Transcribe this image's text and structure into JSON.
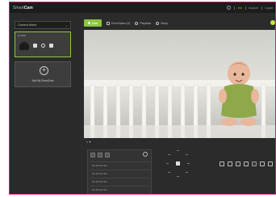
{
  "app": {
    "logo_prefix": "Smart",
    "logo_suffix": "Cam"
  },
  "top_nav": {
    "link1": "Inst",
    "link2": "Account",
    "link3": "Logout"
  },
  "sidebar": {
    "dropdown_label": "Camera Name",
    "camera_card_label": "Ln Crib",
    "add_label": "Add My SmartCam"
  },
  "tabs": {
    "live": "Live",
    "event": "Event Alarm  (0)",
    "playback": "Playback",
    "setup": "Setup"
  },
  "colors": {
    "accent": "#8dc63f",
    "border": "#d6196e"
  },
  "controls": {
    "volume_icon": "speaker-icon",
    "presets": [
      "No Preset Set",
      "No Preset Set",
      "No Preset Set",
      "No Preset Set"
    ]
  }
}
